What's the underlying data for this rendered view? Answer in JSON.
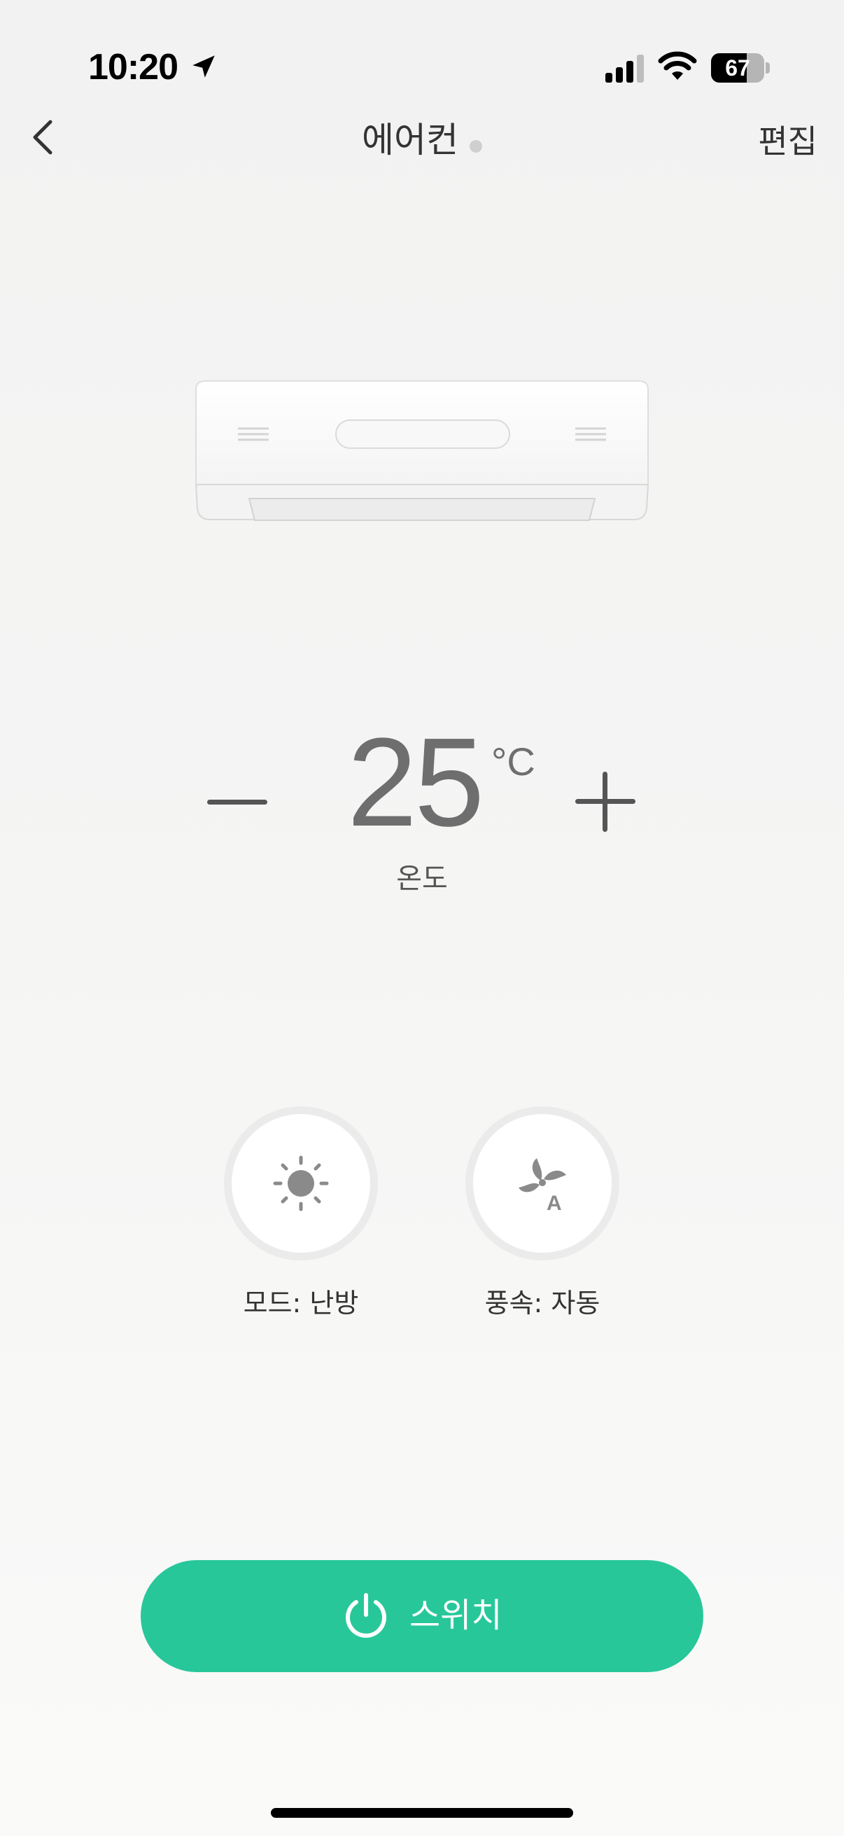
{
  "status_bar": {
    "time": "10:20",
    "battery_level": "67",
    "battery_fraction": 0.67
  },
  "nav": {
    "title": "에어컨",
    "edit_label": "편집"
  },
  "temperature": {
    "value": "25",
    "unit": "°C",
    "label": "온도"
  },
  "controls": {
    "mode": {
      "label": "모드: 난방",
      "icon": "sun-icon"
    },
    "fan": {
      "label": "풍속: 자동",
      "icon": "fan-auto-icon"
    }
  },
  "switch": {
    "label": "스위치",
    "color": "#28c79a"
  }
}
